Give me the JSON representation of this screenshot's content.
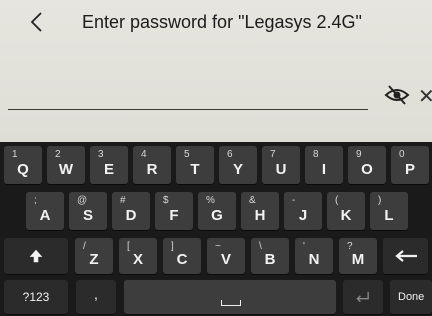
{
  "header": {
    "title": "Enter password for \"Legasys 2.4G\""
  },
  "password": {
    "value": ""
  },
  "keyboard": {
    "row1": [
      {
        "main": "Q",
        "sec": "1"
      },
      {
        "main": "W",
        "sec": "2"
      },
      {
        "main": "E",
        "sec": "3"
      },
      {
        "main": "R",
        "sec": "4"
      },
      {
        "main": "T",
        "sec": "5"
      },
      {
        "main": "Y",
        "sec": "6"
      },
      {
        "main": "U",
        "sec": "7"
      },
      {
        "main": "I",
        "sec": "8"
      },
      {
        "main": "O",
        "sec": "9"
      },
      {
        "main": "P",
        "sec": "0"
      }
    ],
    "row2": [
      {
        "main": "A",
        "sec": ";"
      },
      {
        "main": "S",
        "sec": "@"
      },
      {
        "main": "D",
        "sec": "#"
      },
      {
        "main": "F",
        "sec": "$"
      },
      {
        "main": "G",
        "sec": "%"
      },
      {
        "main": "H",
        "sec": "&"
      },
      {
        "main": "J",
        "sec": "-"
      },
      {
        "main": "K",
        "sec": "("
      },
      {
        "main": "L",
        "sec": ")"
      }
    ],
    "row3": [
      {
        "main": "Z",
        "sec": "/"
      },
      {
        "main": "X",
        "sec": "["
      },
      {
        "main": "C",
        "sec": "]"
      },
      {
        "main": "V",
        "sec": "~"
      },
      {
        "main": "B",
        "sec": "\\"
      },
      {
        "main": "N",
        "sec": "'"
      },
      {
        "main": "M",
        "sec": "?"
      }
    ],
    "shift_icon": "shift-arrow-icon",
    "backspace_icon": "backspace-arrow-icon",
    "symbols_label": "?123",
    "comma_label": ",",
    "enter_icon": "enter-icon",
    "done_label": "Done"
  }
}
